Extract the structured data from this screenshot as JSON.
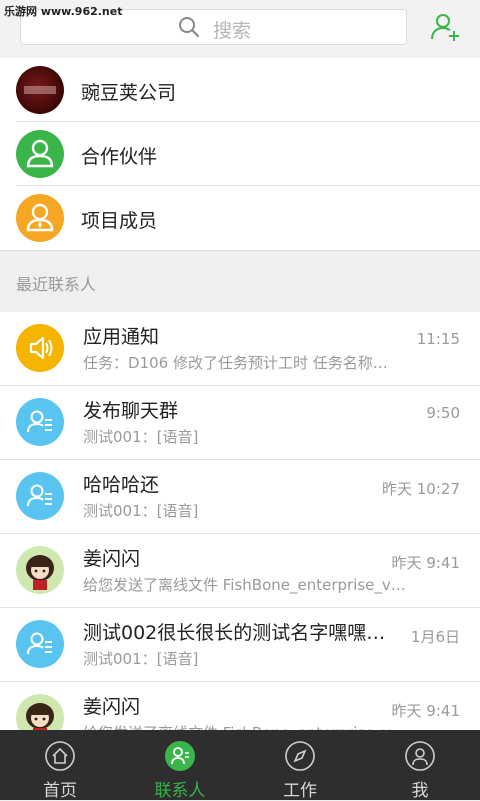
{
  "watermark": "乐游网 www.962.net",
  "search": {
    "placeholder": "搜索"
  },
  "groups": [
    {
      "name": "豌豆荚公司",
      "icon": "company-avatar"
    },
    {
      "name": "合作伙伴",
      "icon": "person-icon"
    },
    {
      "name": "项目成员",
      "icon": "person-icon"
    }
  ],
  "recent_header": "最近联系人",
  "contacts": [
    {
      "title": "应用通知",
      "time": "11:15",
      "subtitle": "任务：D106 修改了任务预计工时 任务名称…",
      "icon": "speaker-icon"
    },
    {
      "title": "发布聊天群",
      "time": "9:50",
      "subtitle": "测试001：[语音]",
      "icon": "group-chat-icon"
    },
    {
      "title": "哈哈哈还",
      "time": "昨天 10:27",
      "subtitle": "测试001：[语音]",
      "icon": "group-chat-icon"
    },
    {
      "title": "姜闪闪",
      "time": "昨天 9:41",
      "subtitle": "给您发送了离线文件 FishBone_enterprise_v…",
      "icon": "cartoon-girl-avatar"
    },
    {
      "title": "测试002很长很长的测试名字嘿嘿…",
      "time": "1月6日",
      "subtitle": "测试001：[语音]",
      "icon": "group-chat-icon"
    },
    {
      "title": "姜闪闪",
      "time": "昨天 9:41",
      "subtitle": "给您发送了离线文件 FishBone_enterprise_v…",
      "icon": "cartoon-girl-avatar"
    }
  ],
  "tabs": [
    {
      "label": "首页",
      "icon": "home-icon"
    },
    {
      "label": "联系人",
      "icon": "contacts-icon"
    },
    {
      "label": "工作",
      "icon": "compass-icon"
    },
    {
      "label": "我",
      "icon": "me-icon"
    }
  ],
  "colors": {
    "accent": "#39b54a",
    "orange": "#f5a623",
    "blue": "#5ac4f0",
    "yellow": "#f5b400",
    "tabbar": "#2e2e2e"
  }
}
